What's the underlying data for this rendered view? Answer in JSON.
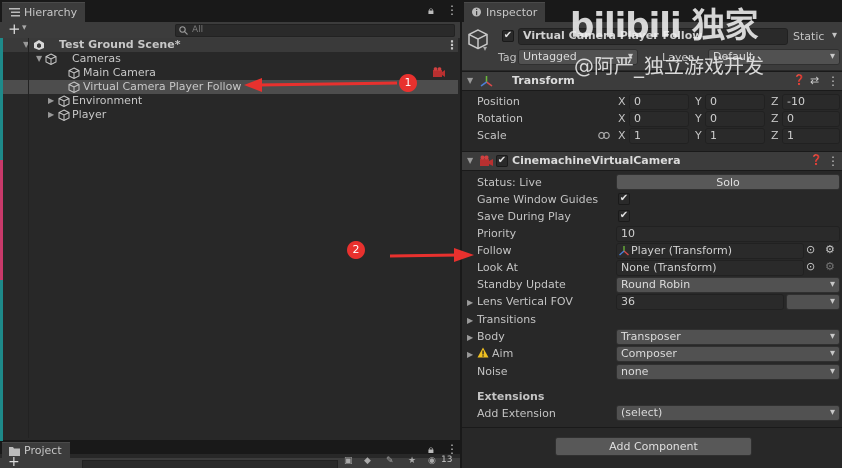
{
  "hierarchy": {
    "tab_label": "Hierarchy",
    "add_label": "+",
    "search_placeholder": "All",
    "scene": "Test Ground Scene*",
    "items": [
      {
        "label": "Cameras"
      },
      {
        "label": "Main Camera"
      },
      {
        "label": "Virtual Camera Player Follow"
      },
      {
        "label": "Environment"
      },
      {
        "label": "Player"
      }
    ]
  },
  "project": {
    "tab_label": "Project",
    "add_label": "+",
    "badge": "13"
  },
  "inspector": {
    "tab_label": "Inspector",
    "object_name": "Virtual Camera Player Follow",
    "static_label": "Static",
    "tag_label": "Tag",
    "tag_value": "Untagged",
    "layer_label": "Layer",
    "layer_value": "Default",
    "transform": {
      "title": "Transform",
      "position": {
        "label": "Position",
        "x": "0",
        "y": "0",
        "z": "-10"
      },
      "rotation": {
        "label": "Rotation",
        "x": "0",
        "y": "0",
        "z": "0"
      },
      "scale": {
        "label": "Scale",
        "x": "1",
        "y": "1",
        "z": "1"
      },
      "axis_x": "X",
      "axis_y": "Y",
      "axis_z": "Z"
    },
    "cinemachine": {
      "title": "CinemachineVirtualCamera",
      "status_label": "Status: Live",
      "solo_label": "Solo",
      "game_window_guides": "Game Window Guides",
      "save_during_play": "Save During Play",
      "priority_label": "Priority",
      "priority_value": "10",
      "follow_label": "Follow",
      "follow_value": "Player (Transform)",
      "look_at_label": "Look At",
      "look_at_value": "None (Transform)",
      "standby_label": "Standby Update",
      "standby_value": "Round Robin",
      "lens_label": "Lens Vertical FOV",
      "lens_value": "36",
      "transitions_label": "Transitions",
      "body_label": "Body",
      "body_value": "Transposer",
      "aim_label": "Aim",
      "aim_value": "Composer",
      "noise_label": "Noise",
      "noise_value": "none",
      "extensions_label": "Extensions",
      "add_extension_label": "Add Extension",
      "add_extension_value": "(select)"
    },
    "add_component_label": "Add Component"
  },
  "watermark": {
    "logo": "bilibili 独家",
    "author": "@阿严_独立游戏开发"
  },
  "annotations": [
    "1",
    "2"
  ],
  "colors": {
    "accent": "#e8312e",
    "selection": "#4d4d4d"
  }
}
